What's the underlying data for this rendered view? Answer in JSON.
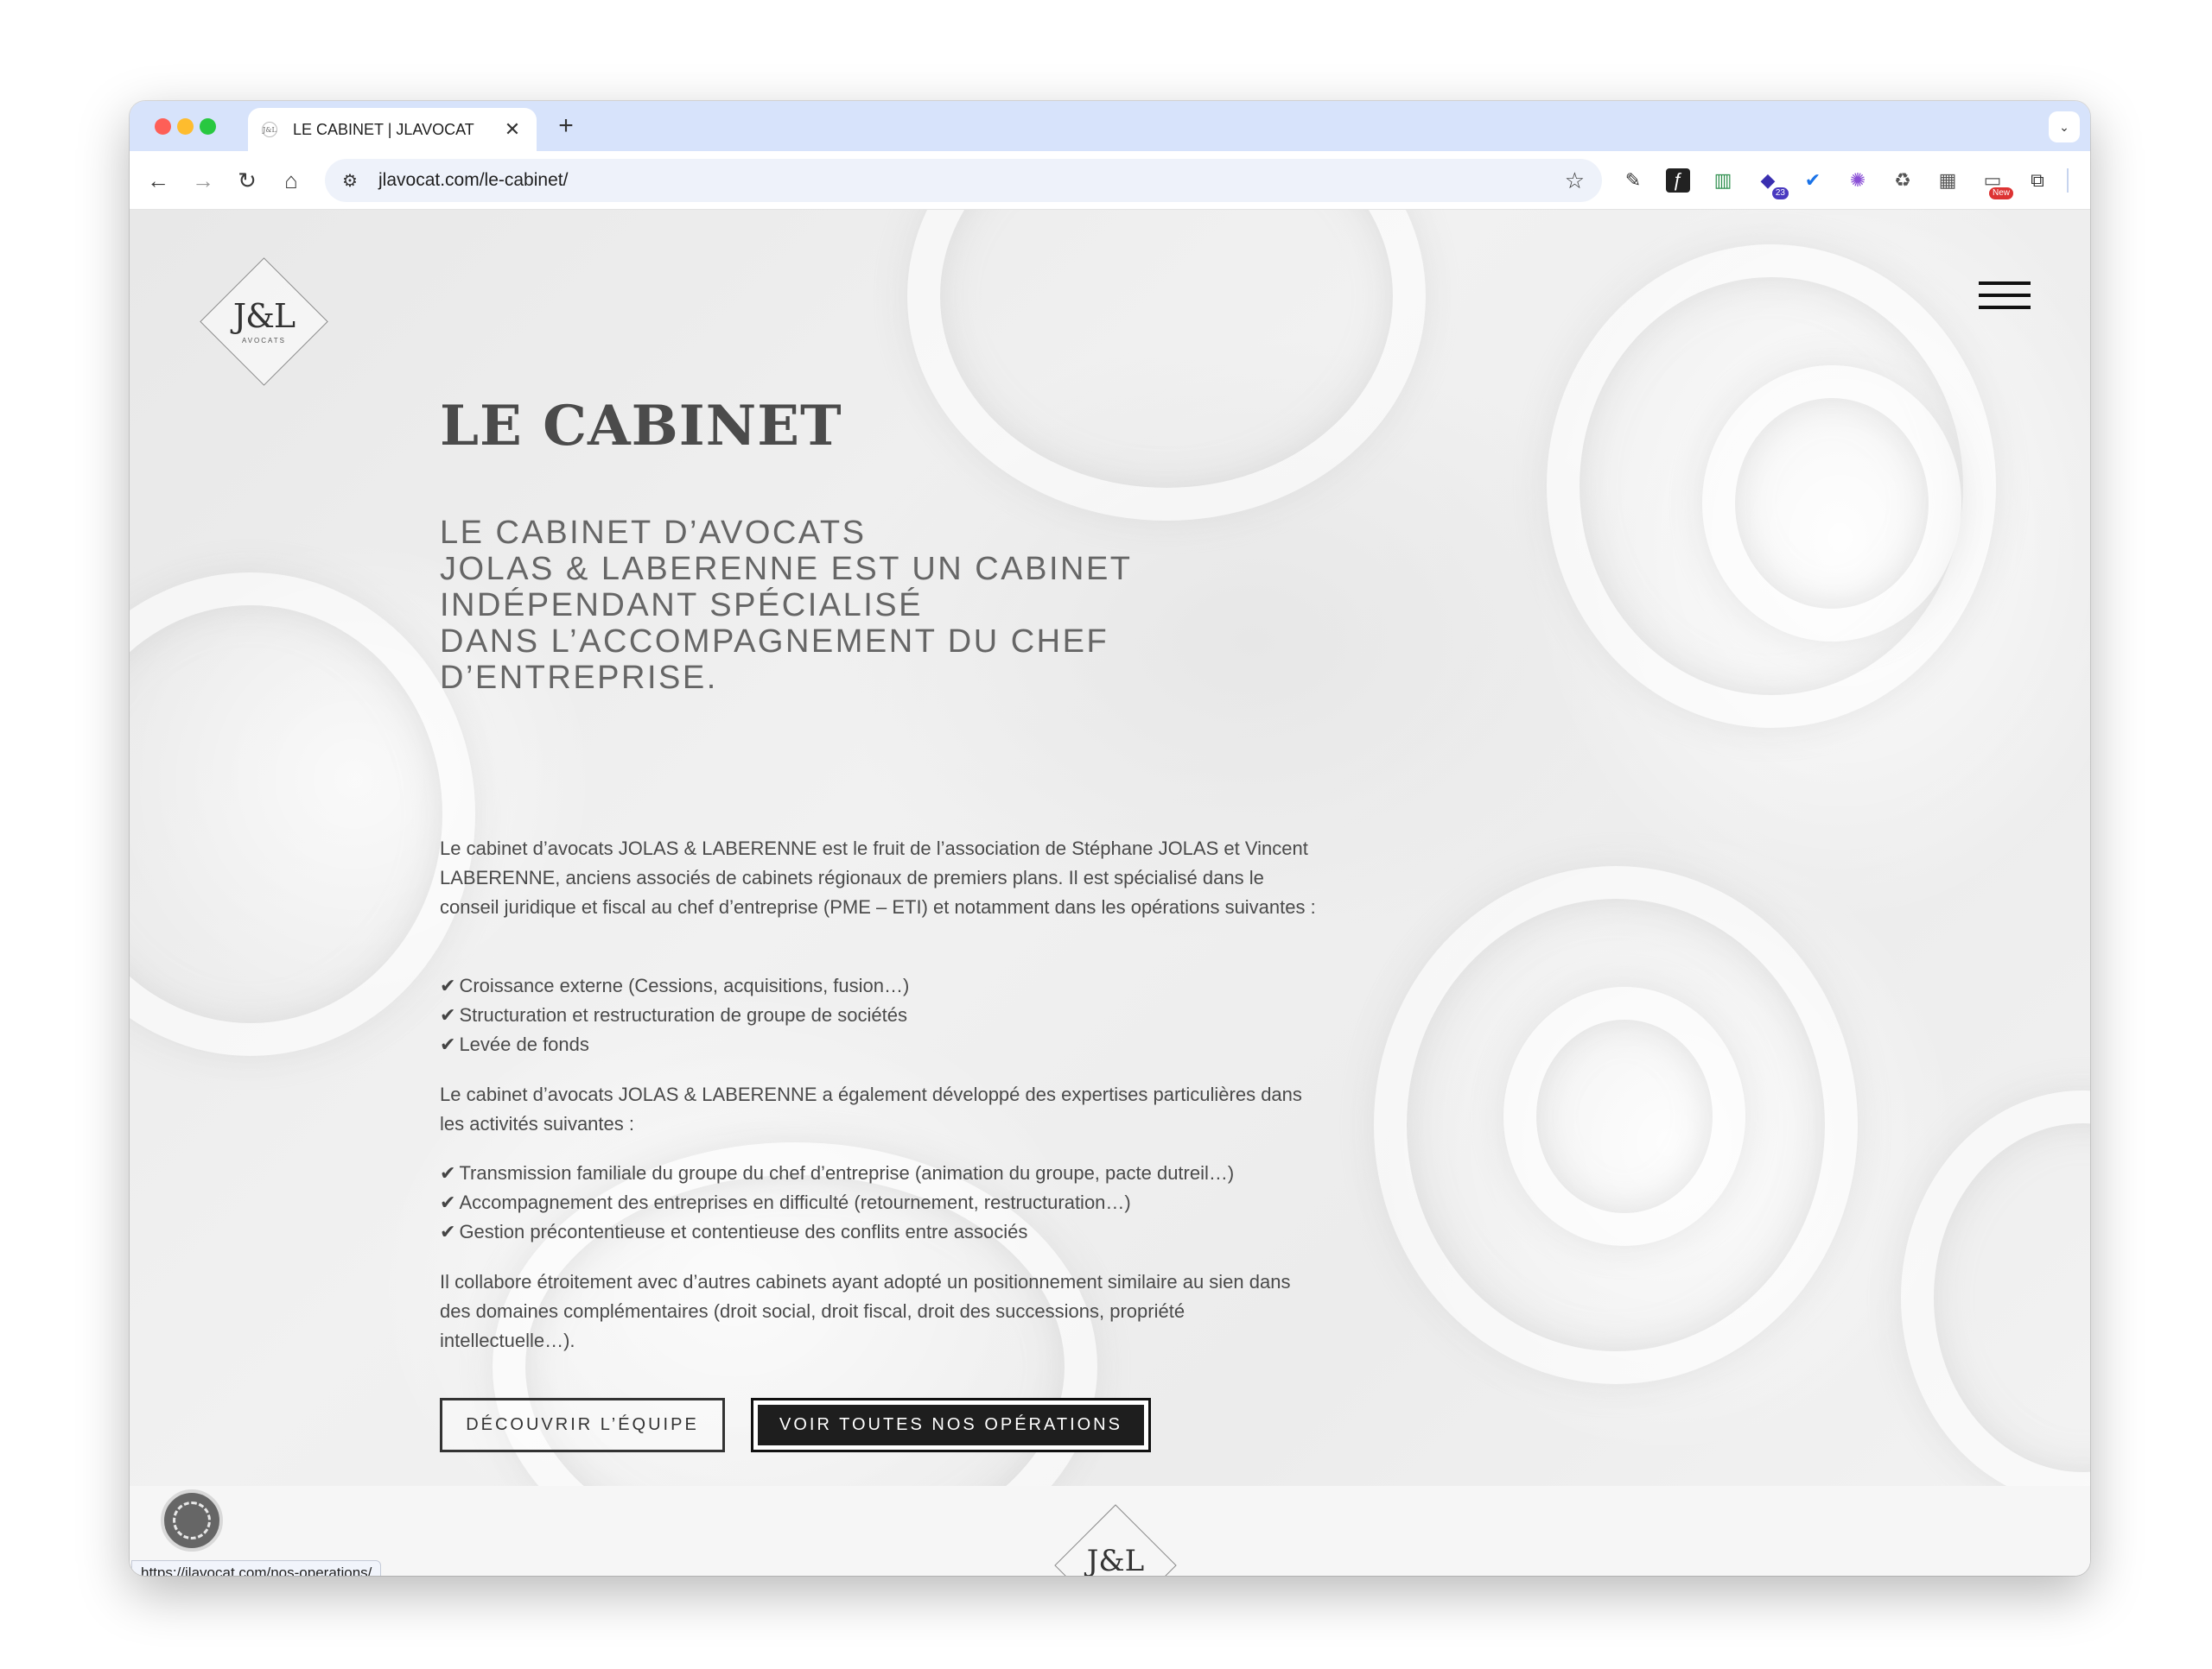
{
  "browser": {
    "tab": {
      "title": "LE CABINET | JLAVOCAT",
      "favicon": "J&L",
      "close": "✕"
    },
    "new_tab": "+",
    "tab_menu": "⌄",
    "nav": {
      "back": "←",
      "forward": "→",
      "reload": "↻",
      "home": "⌂"
    },
    "url": "jlavocat.com/le-cabinet/",
    "site_info_icon": "⚙",
    "bookmark_icon": "☆",
    "extensions": [
      {
        "name": "eyedropper-icon",
        "glyph": "✎"
      },
      {
        "name": "font-icon",
        "glyph": "ƒ"
      },
      {
        "name": "chart-icon",
        "glyph": "▥"
      },
      {
        "name": "grad-cap-icon",
        "glyph": "◆",
        "badge": "23"
      },
      {
        "name": "check-badge-icon",
        "glyph": "✔"
      },
      {
        "name": "gear-flower-icon",
        "glyph": "✺"
      },
      {
        "name": "recycle-icon",
        "glyph": "♻"
      },
      {
        "name": "puzzle-grid-icon",
        "glyph": "▦"
      },
      {
        "name": "new-badge-icon",
        "glyph": "▭",
        "badge": "New"
      },
      {
        "name": "extensions-icon",
        "glyph": "⧉"
      }
    ],
    "reading_list_icon": "☰",
    "menu_icon": "⋮",
    "status_url": "https://jlavocat.com/nos-operations/"
  },
  "site": {
    "logo": {
      "mark": "J&L",
      "sub": "AVOCATS"
    },
    "title": "LE CABINET",
    "subtitle_lines": [
      "LE CABINET D’AVOCATS",
      "JOLAS & LABERENNE EST UN CABINET",
      "INDÉPENDANT SPÉCIALISÉ",
      "DANS L’ACCOMPAGNEMENT DU CHEF",
      "D’ENTREPRISE."
    ],
    "paragraph1": "Le cabinet d’avocats JOLAS & LABERENNE est le fruit de l’association de Stéphane JOLAS et Vincent LABERENNE, anciens associés de cabinets régionaux de premiers plans. Il est spécialisé dans le conseil juridique et fiscal au chef d’entreprise (PME – ETI) et notamment dans les opérations suivantes :",
    "list1": [
      "Croissance externe (Cessions, acquisitions, fusion…)",
      "Structuration et restructuration de groupe de sociétés",
      "Levée de fonds"
    ],
    "paragraph2": "Le cabinet d’avocats JOLAS & LABERENNE a également développé des expertises particulières dans les activités suivantes :",
    "list2": [
      "Transmission familiale du groupe du chef d’entreprise (animation du groupe, pacte dutreil…)",
      "Accompagnement des entreprises en difficulté (retournement, restructuration…)",
      "Gestion précontentieuse et contentieuse des conflits entre associés"
    ],
    "paragraph3": "Il collabore étroitement avec d’autres cabinets ayant adopté un positionnement similaire au sien dans des domaines complémentaires (droit social, droit fiscal, droit des successions, propriété intellectuelle…).",
    "check_mark": "✔",
    "buttons": {
      "team": "DÉCOUVRIR L’ÉQUIPE",
      "operations": "VOIR TOUTES NOS OPÉRATIONS"
    },
    "footer_logo": "J&L"
  },
  "colors": {
    "tabbar": "#d7e3fb",
    "accent_dark": "#1e1e1e",
    "text": "#4a4a4a"
  }
}
